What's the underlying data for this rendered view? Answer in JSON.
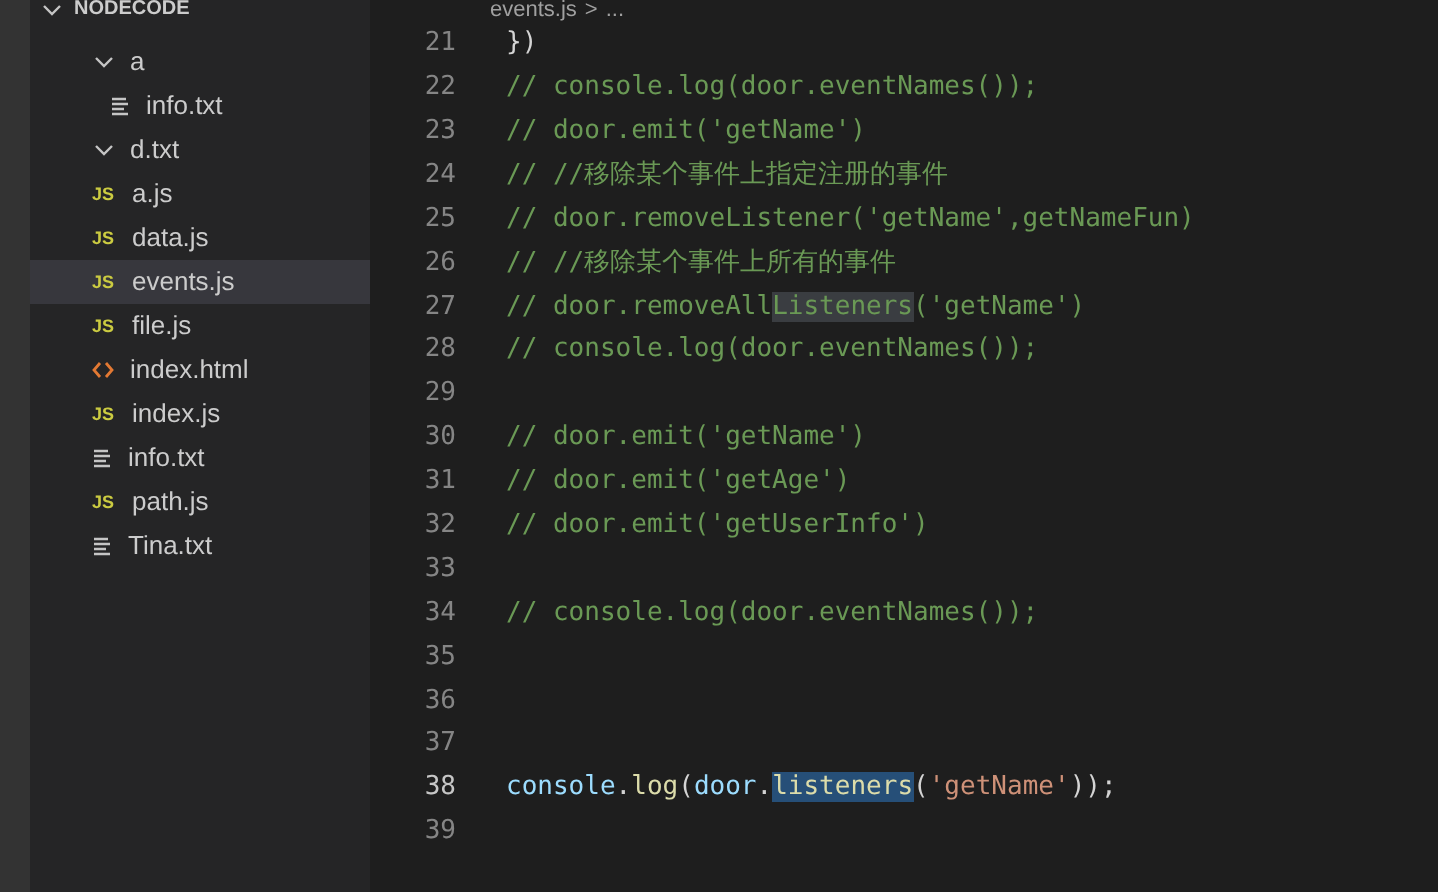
{
  "explorer": {
    "title": "NODECODE",
    "items": [
      {
        "kind": "folder",
        "label": "a",
        "expanded": true,
        "selected": false,
        "children": [
          {
            "kind": "txt",
            "label": "info.txt",
            "selected": false
          }
        ]
      },
      {
        "kind": "folder",
        "label": "d.txt",
        "expanded": true,
        "selected": false
      },
      {
        "kind": "js",
        "icon": "JS",
        "label": "a.js",
        "selected": false
      },
      {
        "kind": "js",
        "icon": "JS",
        "label": "data.js",
        "selected": false
      },
      {
        "kind": "js",
        "icon": "JS",
        "label": "events.js",
        "selected": true
      },
      {
        "kind": "js",
        "icon": "JS",
        "label": "file.js",
        "selected": false
      },
      {
        "kind": "html",
        "label": "index.html",
        "selected": false
      },
      {
        "kind": "js",
        "icon": "JS",
        "label": "index.js",
        "selected": false
      },
      {
        "kind": "txt",
        "label": "info.txt",
        "selected": false
      },
      {
        "kind": "js",
        "icon": "JS",
        "label": "path.js",
        "selected": false
      },
      {
        "kind": "txt",
        "label": "Tina.txt",
        "selected": false
      }
    ]
  },
  "breadcrumb": [
    "events.js",
    ">",
    "..."
  ],
  "editor": {
    "lines": [
      {
        "number": "21",
        "current": false,
        "segments": [
          {
            "kind": "plain",
            "text": "})"
          }
        ]
      },
      {
        "number": "22",
        "current": false,
        "segments": [
          {
            "kind": "comment",
            "text": "// console.log(door.eventNames());"
          }
        ]
      },
      {
        "number": "23",
        "current": false,
        "segments": [
          {
            "kind": "comment",
            "text": "// door.emit('getName')"
          }
        ]
      },
      {
        "number": "24",
        "current": false,
        "segments": [
          {
            "kind": "comment",
            "text": "// //移除某个事件上指定注册的事件"
          }
        ]
      },
      {
        "number": "25",
        "current": false,
        "segments": [
          {
            "kind": "comment",
            "text": "// door.removeListener('getName',getNameFun)"
          }
        ]
      },
      {
        "number": "26",
        "current": false,
        "segments": [
          {
            "kind": "comment",
            "text": "// //移除某个事件上所有的事件"
          }
        ]
      },
      {
        "number": "27",
        "current": false,
        "segments": [
          {
            "kind": "comment",
            "text": "// door.removeAll"
          },
          {
            "kind": "comment",
            "text": "Listeners",
            "word_highlight": true
          },
          {
            "kind": "comment",
            "text": "('getName')"
          }
        ]
      },
      {
        "number": "28",
        "current": false,
        "segments": [
          {
            "kind": "comment",
            "text": "// console.log(door.eventNames());"
          }
        ]
      },
      {
        "number": "29",
        "current": false
      },
      {
        "number": "30",
        "current": false,
        "segments": [
          {
            "kind": "comment",
            "text": "// door.emit('getName')"
          }
        ]
      },
      {
        "number": "31",
        "current": false,
        "segments": [
          {
            "kind": "comment",
            "text": "// door.emit('getAge')"
          }
        ]
      },
      {
        "number": "32",
        "current": false,
        "segments": [
          {
            "kind": "comment",
            "text": "// door.emit('getUserInfo')"
          }
        ]
      },
      {
        "number": "33",
        "current": false
      },
      {
        "number": "34",
        "current": false,
        "segments": [
          {
            "kind": "comment",
            "text": "// console.log(door.eventNames());"
          }
        ]
      },
      {
        "number": "35",
        "current": false
      },
      {
        "number": "36",
        "current": false
      },
      {
        "number": "37",
        "current": false
      },
      {
        "number": "38",
        "current": true,
        "segments": [
          {
            "kind": "variable",
            "text": "console"
          },
          {
            "kind": "plain",
            "text": "."
          },
          {
            "kind": "function",
            "text": "log"
          },
          {
            "kind": "plain",
            "text": "("
          },
          {
            "kind": "variable",
            "text": "door"
          },
          {
            "kind": "plain",
            "text": "."
          },
          {
            "kind": "function",
            "text": "listeners",
            "selected": true
          },
          {
            "kind": "plain",
            "text": "("
          },
          {
            "kind": "string",
            "text": "'getName'"
          },
          {
            "kind": "plain",
            "text": "));"
          }
        ]
      },
      {
        "number": "39",
        "current": false
      }
    ]
  }
}
